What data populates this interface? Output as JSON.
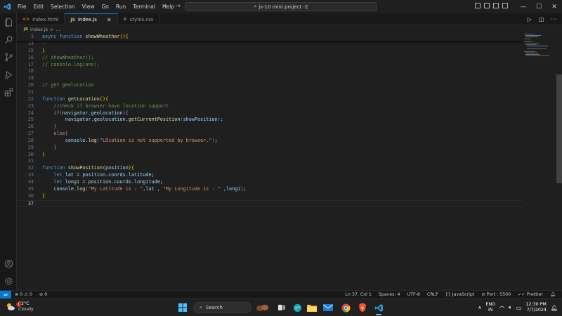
{
  "menu": [
    "File",
    "Edit",
    "Selection",
    "View",
    "Go",
    "Run",
    "Terminal",
    "Help"
  ],
  "command_center": "js-10 mini project -2",
  "tabs": [
    {
      "label": "index.html",
      "badge": "<>",
      "badge_color": "#e37933"
    },
    {
      "label": "index.js",
      "badge": "JS",
      "badge_color": "#cbcb41",
      "close": "✕"
    },
    {
      "label": "styles.css",
      "badge": "#",
      "badge_color": "#519aba"
    }
  ],
  "breadcrumb": {
    "file": "index.js",
    "separator": ">",
    "rest": "..."
  },
  "sticky": {
    "num": "3",
    "code": "async function showWheather(){"
  },
  "lines": [
    {
      "n": "14",
      "c": ""
    },
    {
      "n": "15",
      "c": "}"
    },
    {
      "n": "16",
      "c": "// showWheather();"
    },
    {
      "n": "17",
      "c": "// console.log(ans);"
    },
    {
      "n": "18",
      "c": ""
    },
    {
      "n": "19",
      "c": ""
    },
    {
      "n": "20",
      "c": "// get geolocation"
    },
    {
      "n": "21",
      "c": ""
    },
    {
      "n": "22",
      "c": "function getLocation(){"
    },
    {
      "n": "23",
      "c": "//check if browser have location support"
    },
    {
      "n": "24",
      "c": "if(navigator.geolocation){"
    },
    {
      "n": "25",
      "c": "navigator.geolocation.getCurrentPosition(showPosition);"
    },
    {
      "n": "26",
      "c": "}"
    },
    {
      "n": "27",
      "c": "else{"
    },
    {
      "n": "28",
      "c": "console.log(\"LOcation is not supported by browser.\");"
    },
    {
      "n": "29",
      "c": "}"
    },
    {
      "n": "30",
      "c": "}"
    },
    {
      "n": "31",
      "c": ""
    },
    {
      "n": "32",
      "c": "function showPosition(position){"
    },
    {
      "n": "33",
      "c": "let lat = position.coords.latitude;"
    },
    {
      "n": "34",
      "c": "let longi = position.coords.longitude;"
    },
    {
      "n": "35",
      "c": "console.log(\"My Latitude is : \",lat , \"My Longitude is : \" ,longi);"
    },
    {
      "n": "36",
      "c": "}"
    },
    {
      "n": "37",
      "c": ""
    }
  ],
  "status": {
    "errors": "0",
    "warnings": "0",
    "ports": "0",
    "position": "Ln 37, Col 1",
    "spaces": "Spaces: 4",
    "encoding": "UTF-8",
    "eol": "CRLF",
    "language": "JavaScript",
    "port": "Port : 5500",
    "formatter": "Prettier"
  },
  "taskbar": {
    "temperature": "32°C",
    "condition": "Cloudy",
    "notification_count": "1",
    "search_placeholder": "Search",
    "lang_top": "ENG",
    "lang_bottom": "IN",
    "time": "12:30 PM",
    "date": "7/7/2024"
  },
  "colors": {
    "accent": "#0078d4",
    "keyword": "#569cd6",
    "function": "#dcdcaa",
    "comment": "#6a9955",
    "string": "#ce9178",
    "variable": "#9cdcfe"
  }
}
